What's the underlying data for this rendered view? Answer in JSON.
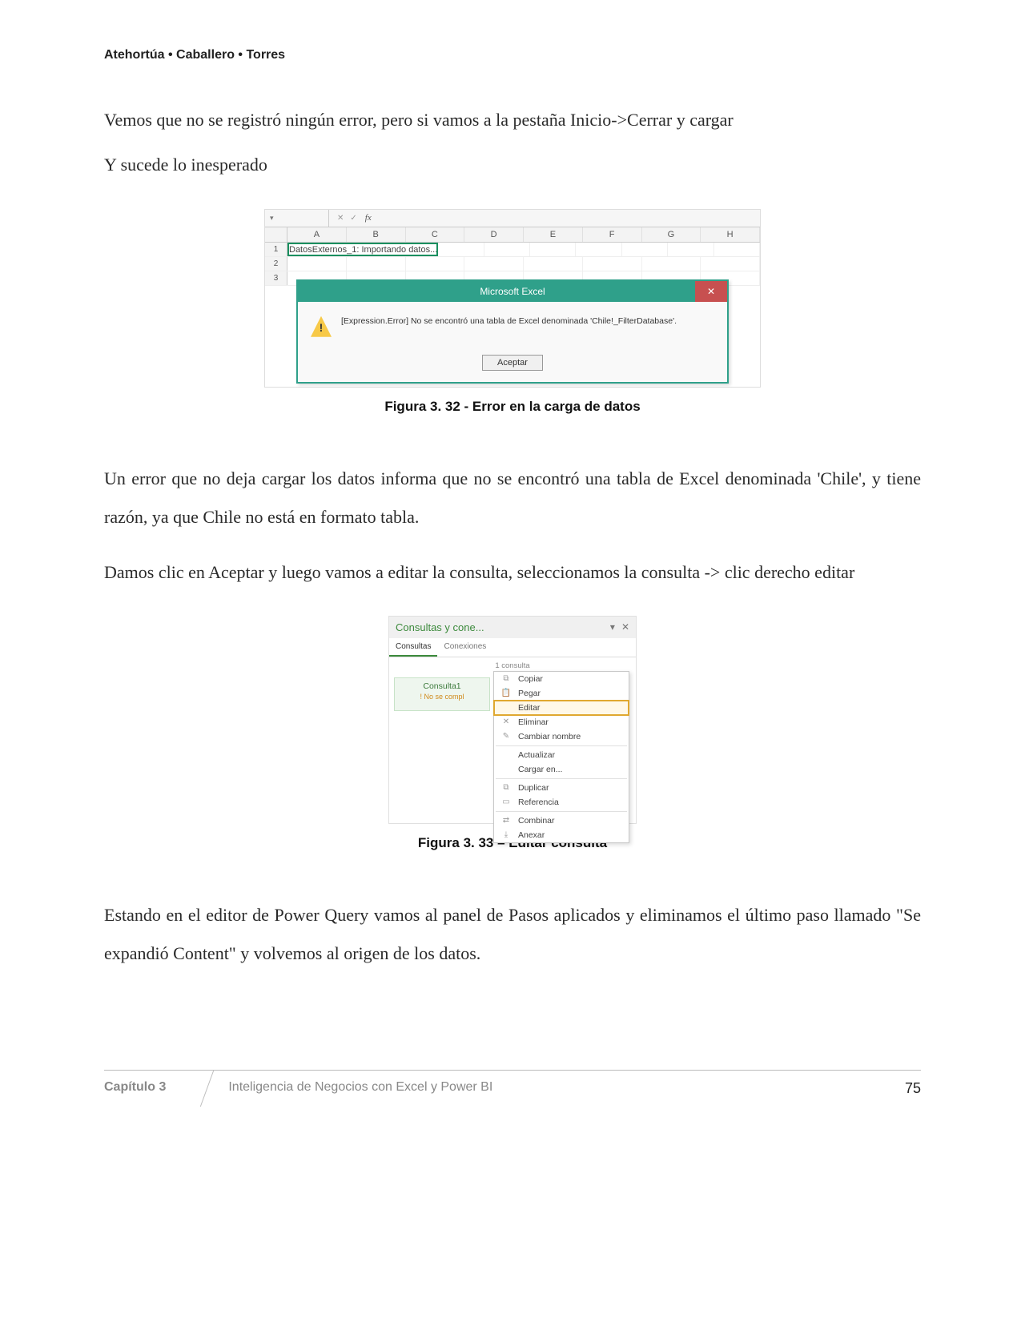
{
  "header": {
    "authors": "Atehortúa • Caballero • Torres"
  },
  "para1": "Vemos que no se registró ningún error, pero si vamos a la pestaña Inicio->Cerrar y cargar",
  "para2": "Y sucede lo inesperado",
  "figure1": {
    "caption": "Figura 3. 32 -  Error en la carga de datos",
    "columns": [
      "A",
      "B",
      "C",
      "D",
      "E",
      "F",
      "G",
      "H"
    ],
    "status_text": "DatosExternos_1: Importando datos...",
    "dialog_title": "Microsoft Excel",
    "dialog_msg": "[Expression.Error] No se encontró una tabla de Excel denominada 'Chile!_FilterDatabase'.",
    "accept_label": "Aceptar",
    "fx_label": "fx"
  },
  "para3": "Un error que no deja cargar los datos informa que no se encontró una tabla de Excel denominada 'Chile', y tiene razón, ya que Chile no está en formato tabla.",
  "para4": "Damos clic en Aceptar y luego vamos a editar la consulta, seleccionamos la consulta -> clic derecho editar",
  "figure2": {
    "caption": "Figura 3. 33 – Editar consulta",
    "pane_title": "Consultas y cone...",
    "tabs": {
      "active": "Consultas",
      "inactive": "Conexiones"
    },
    "count_label": "1 consulta",
    "query_name": "Consulta1",
    "query_warn": "! No se compl",
    "menu": {
      "copiar": "Copiar",
      "pegar": "Pegar",
      "editar": "Editar",
      "eliminar": "Eliminar",
      "cambiar": "Cambiar nombre",
      "actualizar": "Actualizar",
      "cargar": "Cargar en...",
      "duplicar": "Duplicar",
      "referencia": "Referencia",
      "combinar": "Combinar",
      "anexar": "Anexar"
    }
  },
  "para5": "Estando en el editor de Power Query vamos al panel de Pasos aplicados y eliminamos el último paso llamado \"Se expandió Content\" y volvemos al origen de los datos.",
  "footer": {
    "chapter": "Capítulo 3",
    "title": "Inteligencia de Negocios con Excel y Power BI",
    "page": "75"
  }
}
